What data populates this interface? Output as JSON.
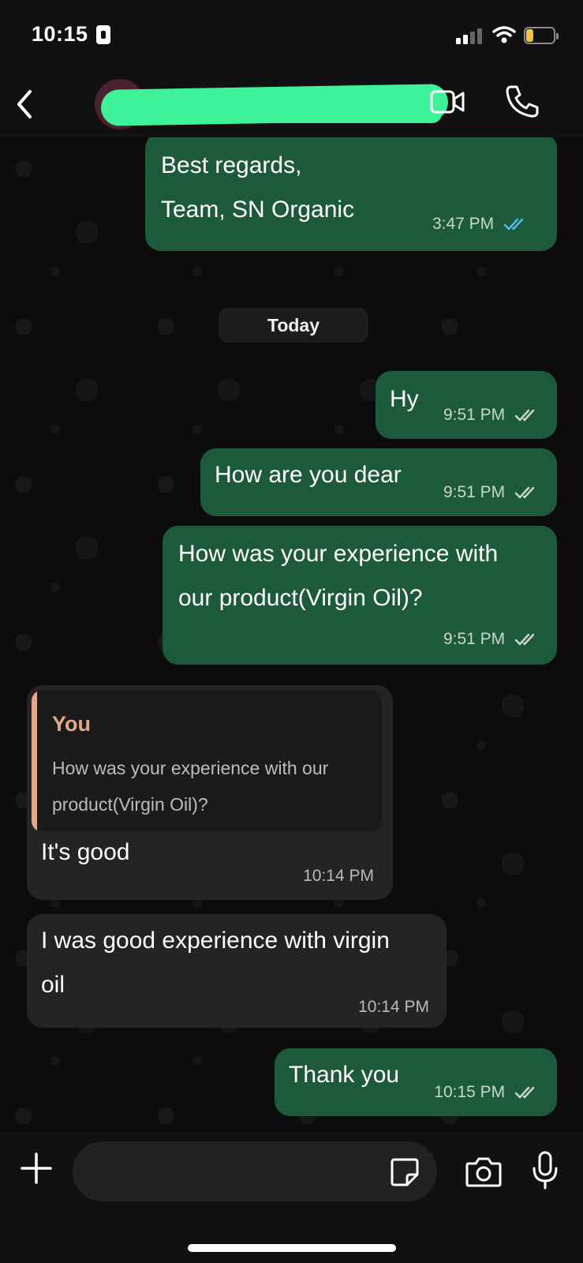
{
  "status_bar": {
    "time": "10:15",
    "battery": "10"
  },
  "header": {
    "contact_name": ""
  },
  "messages": [
    {
      "direction": "out",
      "lines": [
        "Best regards,",
        "Team, SN Organic"
      ],
      "time": "3:47 PM",
      "status": "read"
    },
    {
      "direction": "out",
      "text": "Hy",
      "time": "9:51 PM",
      "status": "delivered"
    },
    {
      "direction": "out",
      "text": "How are you dear",
      "time": "9:51 PM",
      "status": "delivered"
    },
    {
      "direction": "out",
      "lines": [
        "How was your experience with",
        "our product(Virgin Oil)?"
      ],
      "time": "9:51 PM",
      "status": "delivered"
    },
    {
      "direction": "in",
      "quote": {
        "author": "You",
        "lines": [
          "How was your experience with our",
          "product(Virgin Oil)?"
        ]
      },
      "text": "It's good",
      "time": "10:14 PM"
    },
    {
      "direction": "in",
      "lines": [
        "I was good experience with virgin",
        "oil"
      ],
      "time": "10:14 PM"
    },
    {
      "direction": "out",
      "text": "Thank you",
      "time": "10:15 PM",
      "status": "delivered"
    }
  ],
  "date_separator": "Today",
  "composer": {
    "placeholder": ""
  },
  "colors": {
    "outgoing": "#1d5a3b",
    "incoming": "#242424",
    "read_ticks": "#53bdeb",
    "quote_accent": "#e3a88c",
    "redaction": "#3ef29a"
  },
  "icons": [
    "back-chevron-icon",
    "video-call-icon",
    "voice-call-icon",
    "plus-icon",
    "sticker-icon",
    "camera-icon",
    "microphone-icon"
  ]
}
